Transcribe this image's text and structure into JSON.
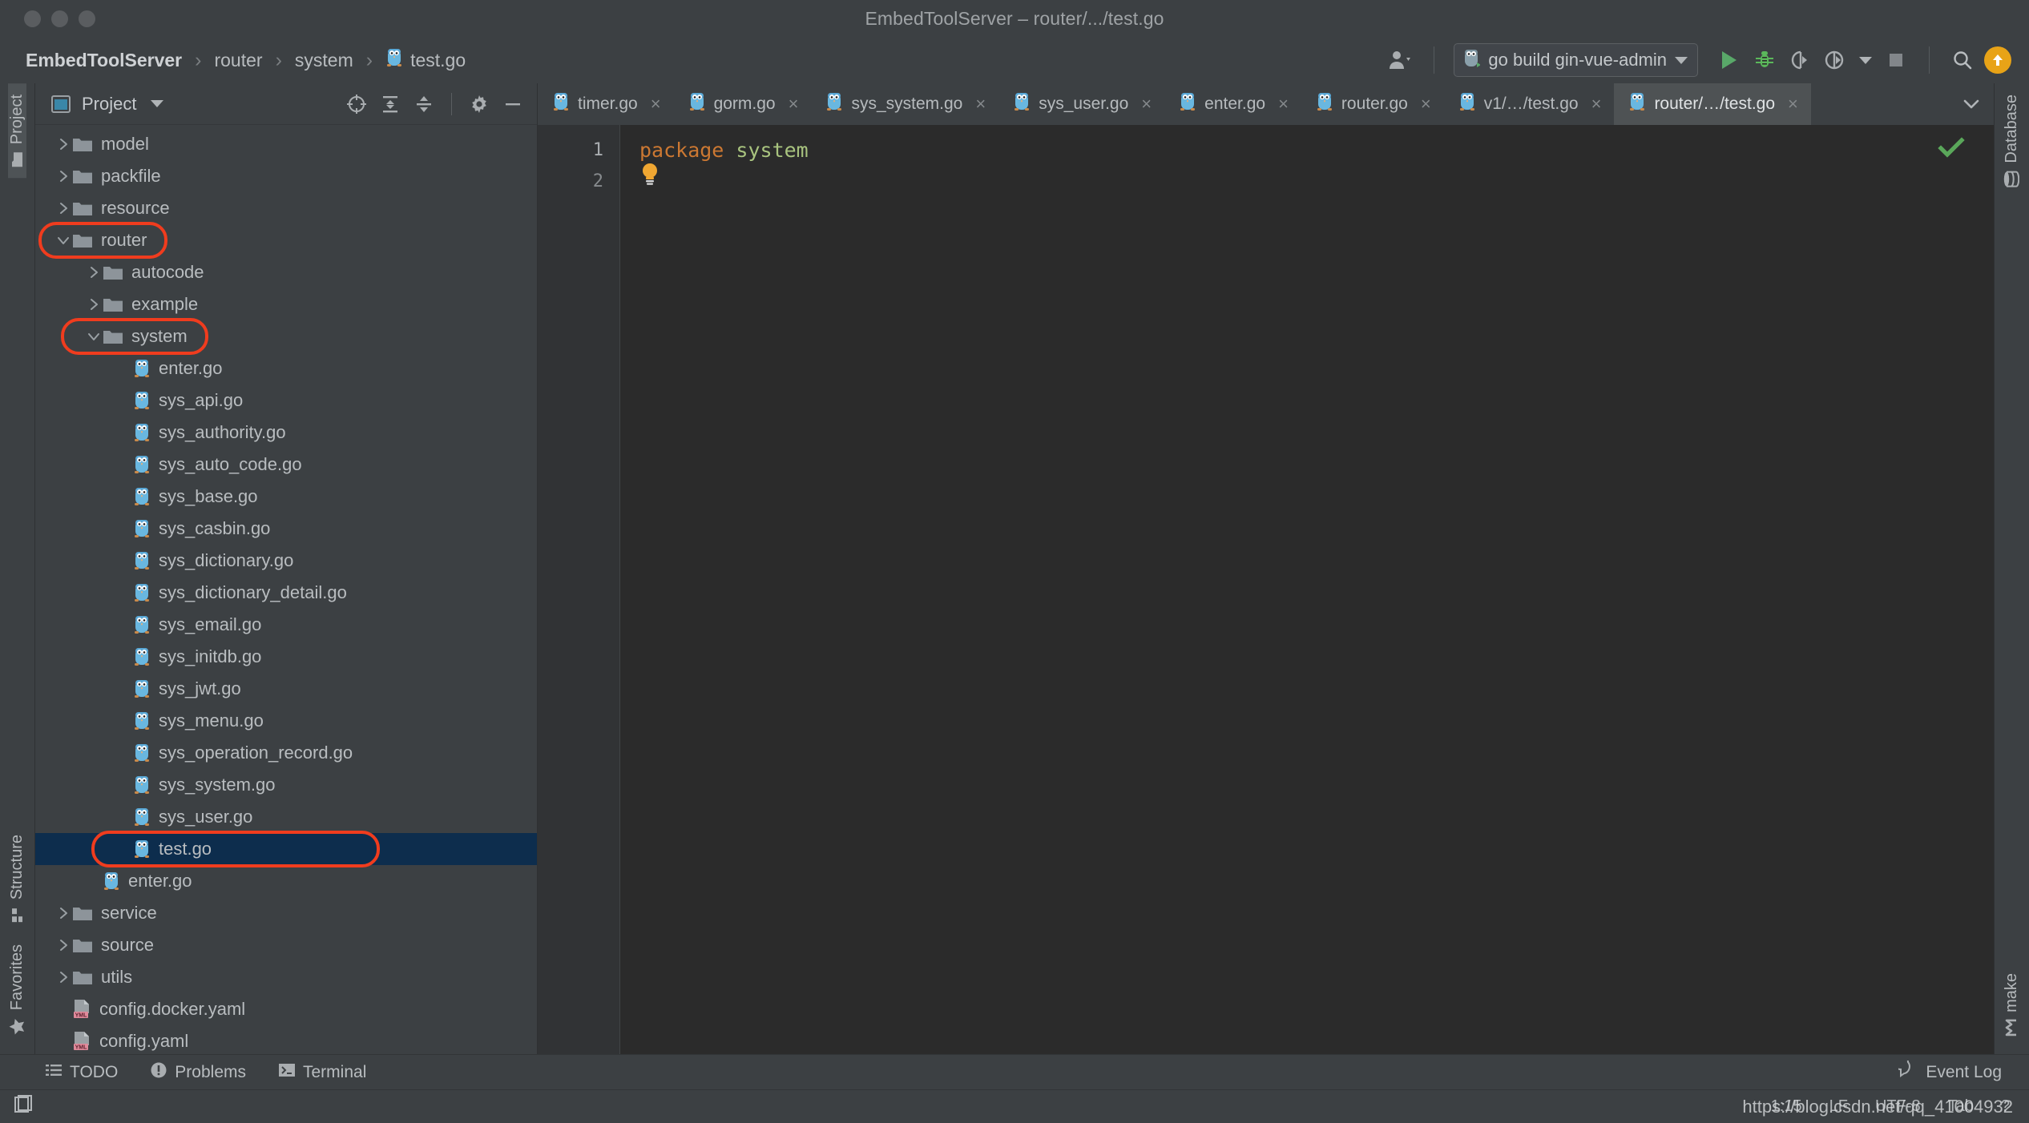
{
  "window": {
    "title": "EmbedToolServer – router/.../test.go",
    "traffic_lights": [
      "close",
      "minimize",
      "maximize"
    ]
  },
  "breadcrumb": {
    "root": "EmbedToolServer",
    "separator": "›",
    "items": [
      "router",
      "system"
    ],
    "file": "test.go"
  },
  "toolbar": {
    "account_icon": "user-account-icon",
    "run_config": {
      "icon": "go-gopher-icon",
      "label": "go build gin-vue-admin",
      "caret": "chevron-down-icon"
    },
    "buttons": [
      {
        "name": "run-button",
        "icon": "play-icon",
        "color": "#59a869"
      },
      {
        "name": "debug-button",
        "icon": "bug-icon",
        "color": "#5bb85b"
      },
      {
        "name": "run-with-coverage-button",
        "icon": "coverage-icon"
      },
      {
        "name": "profiler-button",
        "icon": "profiler-icon"
      },
      {
        "name": "profiler-dropdown",
        "icon": "chevron-down-icon"
      },
      {
        "name": "stop-button",
        "icon": "stop-square-icon"
      },
      {
        "name": "search-everywhere-button",
        "icon": "search-icon"
      },
      {
        "name": "update-available-button",
        "icon": "arrow-up-icon",
        "color": "#e8a317"
      }
    ]
  },
  "left_rail": {
    "top": [
      {
        "label": "Project",
        "icon": "project-folder-icon",
        "active": true
      }
    ],
    "bottom": [
      {
        "label": "Structure",
        "icon": "structure-icon",
        "active": false
      },
      {
        "label": "Favorites",
        "icon": "star-icon",
        "active": false
      }
    ]
  },
  "right_rail": {
    "top": [
      {
        "label": "Database",
        "icon": "database-icon"
      }
    ],
    "bottom": [
      {
        "label": "make",
        "icon": "make-icon"
      }
    ]
  },
  "project_panel": {
    "title": "Project",
    "title_caret": "chevron-down-icon",
    "header_icons": [
      "locate-target-icon",
      "expand-all-icon",
      "collapse-all-icon",
      "gear-icon",
      "hide-icon"
    ],
    "tree": [
      {
        "label": "model",
        "indent": 1,
        "arrow": "collapsed",
        "icon": "folder",
        "highlight": false
      },
      {
        "label": "packfile",
        "indent": 1,
        "arrow": "collapsed",
        "icon": "folder",
        "highlight": false
      },
      {
        "label": "resource",
        "indent": 1,
        "arrow": "collapsed",
        "icon": "folder",
        "highlight": false
      },
      {
        "label": "router",
        "indent": 1,
        "arrow": "expanded",
        "icon": "folder",
        "highlight": true
      },
      {
        "label": "autocode",
        "indent": 2,
        "arrow": "collapsed",
        "icon": "folder",
        "highlight": false
      },
      {
        "label": "example",
        "indent": 2,
        "arrow": "collapsed",
        "icon": "folder",
        "highlight": false
      },
      {
        "label": "system",
        "indent": 2,
        "arrow": "expanded",
        "icon": "folder",
        "highlight": true
      },
      {
        "label": "enter.go",
        "indent": 3,
        "arrow": "none",
        "icon": "go",
        "highlight": false
      },
      {
        "label": "sys_api.go",
        "indent": 3,
        "arrow": "none",
        "icon": "go",
        "highlight": false
      },
      {
        "label": "sys_authority.go",
        "indent": 3,
        "arrow": "none",
        "icon": "go",
        "highlight": false
      },
      {
        "label": "sys_auto_code.go",
        "indent": 3,
        "arrow": "none",
        "icon": "go",
        "highlight": false
      },
      {
        "label": "sys_base.go",
        "indent": 3,
        "arrow": "none",
        "icon": "go",
        "highlight": false
      },
      {
        "label": "sys_casbin.go",
        "indent": 3,
        "arrow": "none",
        "icon": "go",
        "highlight": false
      },
      {
        "label": "sys_dictionary.go",
        "indent": 3,
        "arrow": "none",
        "icon": "go",
        "highlight": false
      },
      {
        "label": "sys_dictionary_detail.go",
        "indent": 3,
        "arrow": "none",
        "icon": "go",
        "highlight": false
      },
      {
        "label": "sys_email.go",
        "indent": 3,
        "arrow": "none",
        "icon": "go",
        "highlight": false
      },
      {
        "label": "sys_initdb.go",
        "indent": 3,
        "arrow": "none",
        "icon": "go",
        "highlight": false
      },
      {
        "label": "sys_jwt.go",
        "indent": 3,
        "arrow": "none",
        "icon": "go",
        "highlight": false
      },
      {
        "label": "sys_menu.go",
        "indent": 3,
        "arrow": "none",
        "icon": "go",
        "highlight": false
      },
      {
        "label": "sys_operation_record.go",
        "indent": 3,
        "arrow": "none",
        "icon": "go",
        "highlight": false
      },
      {
        "label": "sys_system.go",
        "indent": 3,
        "arrow": "none",
        "icon": "go",
        "highlight": false
      },
      {
        "label": "sys_user.go",
        "indent": 3,
        "arrow": "none",
        "icon": "go",
        "highlight": false
      },
      {
        "label": "test.go",
        "indent": 3,
        "arrow": "none",
        "icon": "go",
        "highlight": true,
        "selected": true
      },
      {
        "label": "enter.go",
        "indent": 2,
        "arrow": "none",
        "icon": "go",
        "highlight": false
      },
      {
        "label": "service",
        "indent": 1,
        "arrow": "collapsed",
        "icon": "folder",
        "highlight": false
      },
      {
        "label": "source",
        "indent": 1,
        "arrow": "collapsed",
        "icon": "folder",
        "highlight": false
      },
      {
        "label": "utils",
        "indent": 1,
        "arrow": "collapsed",
        "icon": "folder",
        "highlight": false
      },
      {
        "label": "config.docker.yaml",
        "indent": 1,
        "arrow": "none",
        "icon": "yaml",
        "highlight": false
      },
      {
        "label": "config.yaml",
        "indent": 1,
        "arrow": "none",
        "icon": "yaml",
        "highlight": false
      }
    ]
  },
  "editor": {
    "tabs": [
      {
        "label": "timer.go",
        "icon": "go-file-icon",
        "active": false,
        "close": "×"
      },
      {
        "label": "gorm.go",
        "icon": "go-file-icon",
        "active": false,
        "close": "×"
      },
      {
        "label": "sys_system.go",
        "icon": "go-file-icon",
        "active": false,
        "close": "×"
      },
      {
        "label": "sys_user.go",
        "icon": "go-file-icon",
        "active": false,
        "close": "×"
      },
      {
        "label": "enter.go",
        "icon": "go-file-icon",
        "active": false,
        "close": "×"
      },
      {
        "label": "router.go",
        "icon": "go-file-icon",
        "active": false,
        "close": "×"
      },
      {
        "label": "v1/…/test.go",
        "icon": "go-file-icon",
        "active": false,
        "close": "×"
      },
      {
        "label": "router/…/test.go",
        "icon": "go-file-icon",
        "active": true,
        "close": "×"
      }
    ],
    "tabs_overflow_icon": "chevron-down-icon",
    "gutter_lines": [
      "1",
      "2"
    ],
    "code": {
      "line1_keyword": "package",
      "line1_name": "system",
      "line2": ""
    },
    "inspection_status": "ok-check-icon",
    "intention_bulb": "lightbulb-icon"
  },
  "tool_window_bar": {
    "items": [
      {
        "label": "TODO",
        "icon": "todo-list-icon"
      },
      {
        "label": "Problems",
        "icon": "problems-icon"
      },
      {
        "label": "Terminal",
        "icon": "terminal-icon"
      }
    ],
    "right": {
      "label": "Event Log",
      "icon": "event-log-icon"
    }
  },
  "status_bar": {
    "left_icon": "hide-tool-windows-icon",
    "caret_position": "1:15",
    "line_separator": "LF",
    "encoding": "UTF-8",
    "indent": "Tab",
    "lock": "?",
    "watermark": "https://blog.csdn.net/qq_41004932"
  },
  "colors": {
    "window_bg": "#3c4043",
    "editor_bg": "#2b2b2b",
    "gutter_bg": "#313335",
    "selection_bg": "#0d2d4d",
    "annotation_red": "#f03c1e",
    "accent_green": "#59a869",
    "accent_orange": "#e8a317",
    "keyword_orange": "#cc7832",
    "package_green": "#a9c47f",
    "text_primary": "#b9bdc0"
  }
}
